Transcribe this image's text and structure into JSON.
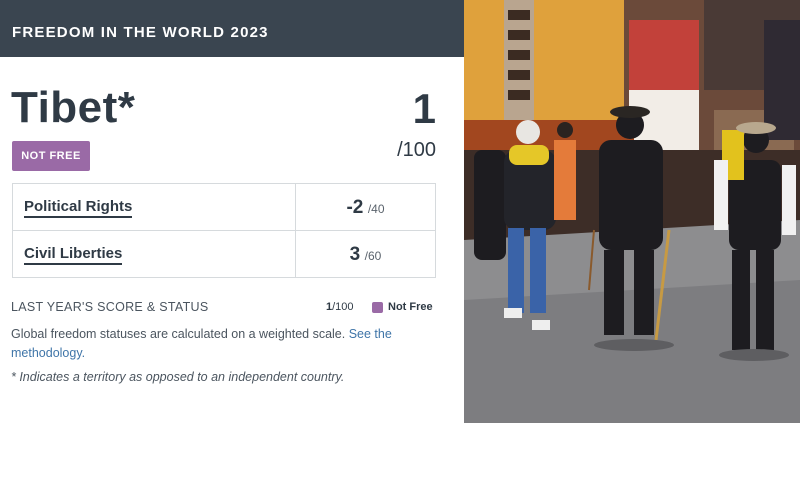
{
  "header": {
    "title": "FREEDOM IN THE WORLD 2023"
  },
  "country": {
    "name": "Tibet*",
    "status": "NOT FREE"
  },
  "total_score": {
    "value": "1",
    "denominator": "/100"
  },
  "scores": [
    {
      "label": "Political Rights",
      "value": "-2",
      "denominator": "/40"
    },
    {
      "label": "Civil Liberties",
      "value": "3",
      "denominator": "/60"
    }
  ],
  "last_year": {
    "label": "LAST YEAR'S SCORE & STATUS",
    "score": "1",
    "denominator": "/100",
    "status": "Not Free"
  },
  "description": {
    "text": "Global freedom statuses are calculated on a weighted scale.",
    "link": "See the methodology."
  },
  "note": "* Indicates a territory as opposed to an independent country.",
  "colors": {
    "header_bg": "#3a4550",
    "not_free": "#9a6aa6",
    "link": "#3f75a8"
  },
  "photo_icons": [
    "street-photo"
  ]
}
